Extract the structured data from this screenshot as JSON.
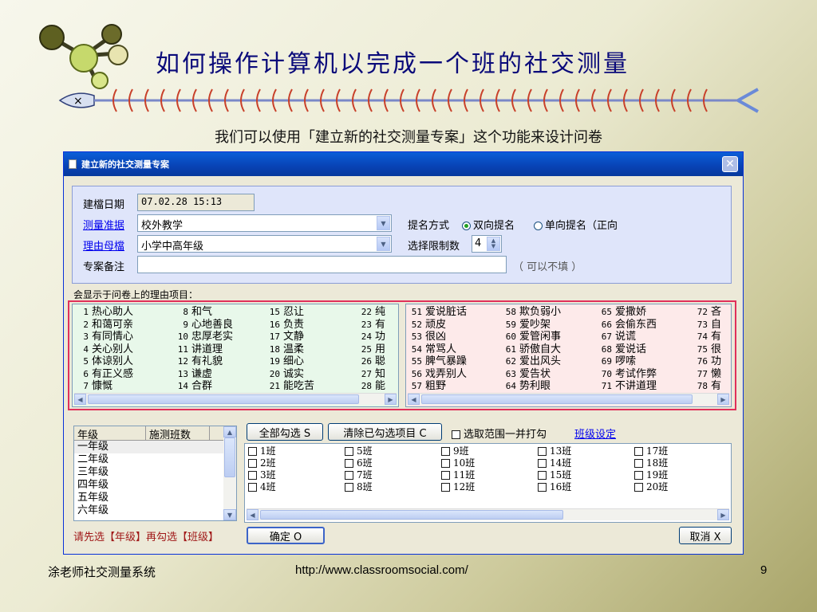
{
  "slide": {
    "title": "如何操作计算机以完成一个班的社交测量",
    "subtitle": "我们可以使用「建立新的社交测量专案」这个功能来设计问卷",
    "footer_left": "涂老师社交测量系统",
    "footer_url": "http://www.classroomsocial.com/",
    "page_number": "9"
  },
  "dialog": {
    "title": "建立新的社交测量专案",
    "close_label": "✕",
    "fields": {
      "created_label": "建檔日期",
      "created_value": "07.02.28 15:13",
      "criterion_label": "测量准据",
      "criterion_value": "校外教学",
      "reason_pool_label": "理由母檔",
      "reason_pool_value": "小学中高年级",
      "notes_label": "专案备注",
      "notes_value": "",
      "notes_hint": "（ 可以不填 ）",
      "nomination_label": "提名方式",
      "nomination_option1": "双向提名",
      "nomination_option2": "单向提名（正向",
      "limit_label": "选择限制数",
      "limit_value": "4"
    },
    "reasons_heading": "会显示于问卷上的理由项目：",
    "positive_reasons": [
      [
        [
          "1",
          "热心助人"
        ],
        [
          "2",
          "和蔼可亲"
        ],
        [
          "3",
          "有同情心"
        ],
        [
          "4",
          "关心别人"
        ],
        [
          "5",
          "体谅别人"
        ],
        [
          "6",
          "有正义感"
        ],
        [
          "7",
          "慷慨"
        ]
      ],
      [
        [
          "8",
          "和气"
        ],
        [
          "9",
          "心地善良"
        ],
        [
          "10",
          "忠厚老实"
        ],
        [
          "11",
          "讲道理"
        ],
        [
          "12",
          "有礼貌"
        ],
        [
          "13",
          "谦虚"
        ],
        [
          "14",
          "合群"
        ]
      ],
      [
        [
          "15",
          "忍让"
        ],
        [
          "16",
          "负责"
        ],
        [
          "17",
          "文静"
        ],
        [
          "18",
          "温柔"
        ],
        [
          "19",
          "细心"
        ],
        [
          "20",
          "诚实"
        ],
        [
          "21",
          "能吃苦"
        ]
      ],
      [
        [
          "22",
          "纯"
        ],
        [
          "23",
          "有"
        ],
        [
          "24",
          "功"
        ],
        [
          "25",
          "用"
        ],
        [
          "26",
          "聪"
        ],
        [
          "27",
          "知"
        ],
        [
          "28",
          "能"
        ]
      ]
    ],
    "negative_reasons": [
      [
        [
          "51",
          "爱说脏话"
        ],
        [
          "52",
          "顽皮"
        ],
        [
          "53",
          "很凶"
        ],
        [
          "54",
          "常骂人"
        ],
        [
          "55",
          "脾气暴躁"
        ],
        [
          "56",
          "戏弄别人"
        ],
        [
          "57",
          "粗野"
        ]
      ],
      [
        [
          "58",
          "欺负弱小"
        ],
        [
          "59",
          "爱吵架"
        ],
        [
          "60",
          "爱管闲事"
        ],
        [
          "61",
          "骄傲自大"
        ],
        [
          "62",
          "爱出风头"
        ],
        [
          "63",
          "爱告状"
        ],
        [
          "64",
          "势利眼"
        ]
      ],
      [
        [
          "65",
          "爱撒娇"
        ],
        [
          "66",
          "会偷东西"
        ],
        [
          "67",
          "说谎"
        ],
        [
          "68",
          "爱说话"
        ],
        [
          "69",
          "啰嗦"
        ],
        [
          "70",
          "考试作弊"
        ],
        [
          "71",
          "不讲道理"
        ]
      ],
      [
        [
          "72",
          "吝"
        ],
        [
          "73",
          "自"
        ],
        [
          "74",
          "有"
        ],
        [
          "75",
          "很"
        ],
        [
          "76",
          "功"
        ],
        [
          "77",
          "懒"
        ],
        [
          "78",
          "有"
        ]
      ]
    ],
    "grade_table": {
      "col_grade": "年级",
      "col_classes": "施测班数",
      "rows": [
        "一年级",
        "二年级",
        "三年级",
        "四年级",
        "五年级",
        "六年级"
      ]
    },
    "buttons": {
      "select_all": "全部勾选 S",
      "clear_all": "清除已勾选项目 C",
      "select_range": "选取范围一并打勾",
      "class_settings": "班级设定",
      "ok": "确定 O",
      "cancel": "取消 X"
    },
    "classes": [
      [
        "1班",
        "2班",
        "3班",
        "4班"
      ],
      [
        "5班",
        "6班",
        "7班",
        "8班"
      ],
      [
        "9班",
        "10班",
        "11班",
        "12班"
      ],
      [
        "13班",
        "14班",
        "15班",
        "16班"
      ],
      [
        "17班",
        "18班",
        "19班",
        "20班"
      ]
    ],
    "hint_text": "请先选【年级】再勾选【班级】"
  }
}
